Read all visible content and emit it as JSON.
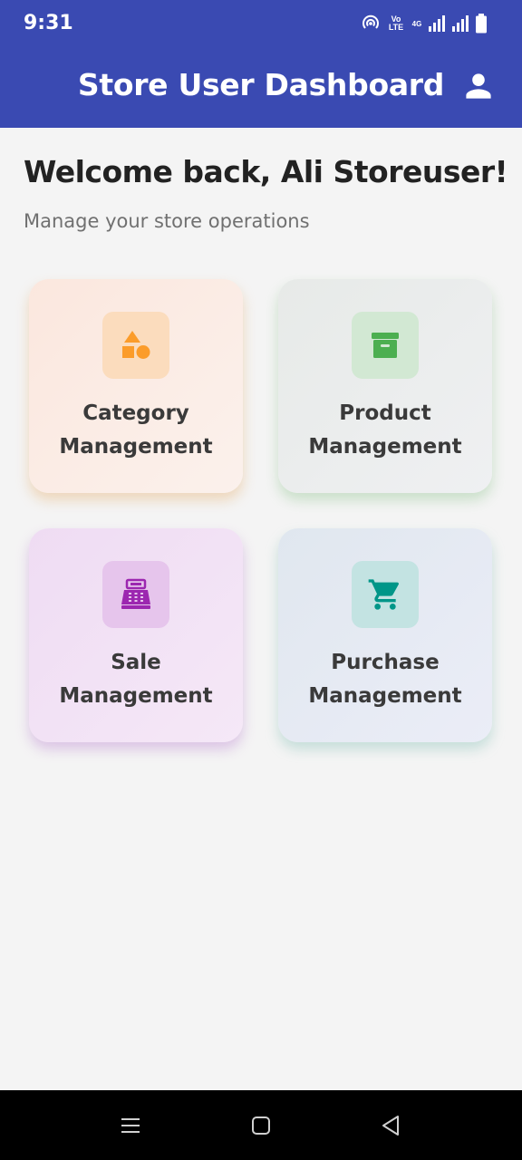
{
  "status_bar": {
    "time": "9:31",
    "network_label": "Vo LTE",
    "network_badge": "4G",
    "icons": [
      "hotspot-icon",
      "volte-icon",
      "signal-icon",
      "signal-icon",
      "battery-icon"
    ]
  },
  "appbar": {
    "title": "Store User Dashboard",
    "profile_icon": "person-icon",
    "background": "#3a4ab2"
  },
  "welcome": {
    "heading": "Welcome back, Ali Storeuser!",
    "subtitle": "Manage your store operations"
  },
  "cards": [
    {
      "line1": "Category",
      "line2": "Management",
      "icon": "shapes-icon",
      "icon_color": "#fb9c2a",
      "icon_bg": "#fbdcbd"
    },
    {
      "line1": "Product",
      "line2": "Management",
      "icon": "archive-icon",
      "icon_color": "#4caf50",
      "icon_bg": "#d2e8d3"
    },
    {
      "line1": "Sale",
      "line2": "Management",
      "icon": "cash-register-icon",
      "icon_color": "#9c27b0",
      "icon_bg": "#e6c5ec"
    },
    {
      "line1": "Purchase",
      "line2": "Management",
      "icon": "cart-icon",
      "icon_color": "#009688",
      "icon_bg": "#c3e3e2"
    }
  ],
  "nav_bar": {
    "buttons": [
      "menu-icon",
      "home-icon",
      "back-icon"
    ]
  }
}
